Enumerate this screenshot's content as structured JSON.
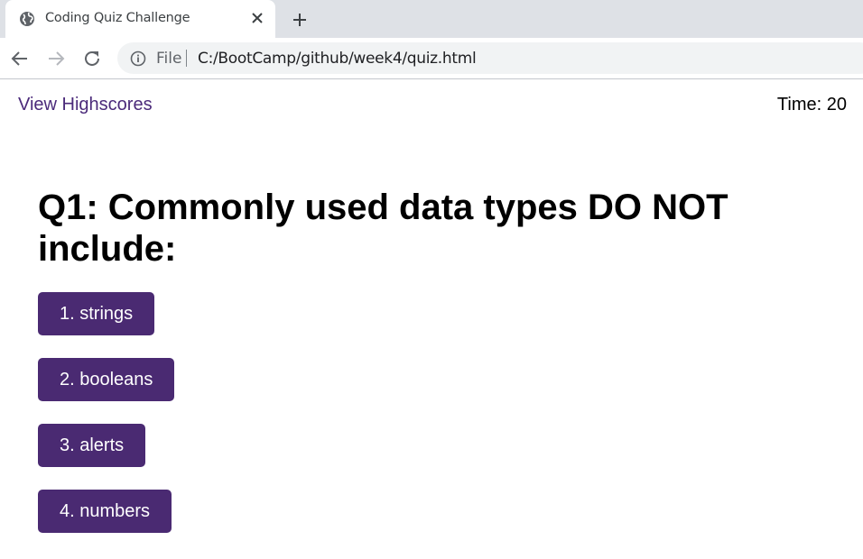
{
  "browser": {
    "tab_title": "Coding Quiz Challenge",
    "url_scheme": "File",
    "url": "C:/BootCamp/github/week4/quiz.html"
  },
  "header": {
    "highscores_link": "View Highscores",
    "timer_label": "Time:",
    "timer_value": "20"
  },
  "quiz": {
    "question": "Q1: Commonly used data types DO NOT include:",
    "answers": [
      "1. strings",
      "2. booleans",
      "3. alerts",
      "4. numbers"
    ]
  },
  "colors": {
    "button_bg": "#4a2a72",
    "link": "#4b2a7a"
  }
}
